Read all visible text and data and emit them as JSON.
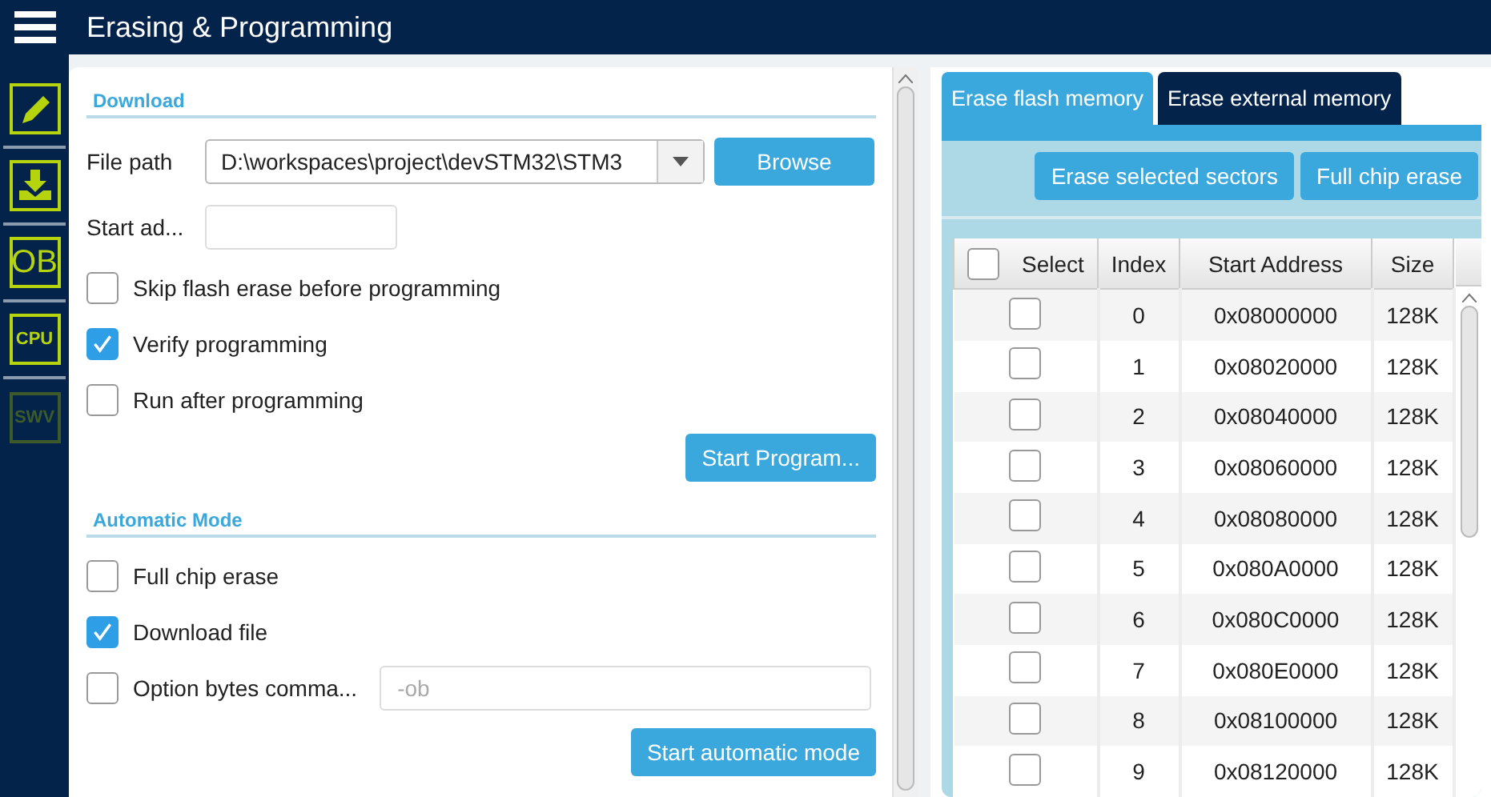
{
  "header": {
    "title": "Erasing & Programming"
  },
  "sidebar": {
    "items": [
      {
        "kind": "edit",
        "disabled": false
      },
      {
        "kind": "download",
        "disabled": false
      },
      {
        "kind": "text",
        "label": "OB",
        "disabled": false
      },
      {
        "kind": "text",
        "label": "CPU",
        "disabled": false
      },
      {
        "kind": "text",
        "label": "SWV",
        "disabled": true
      }
    ]
  },
  "download": {
    "title": "Download",
    "file_path": {
      "label": "File path",
      "value": "D:\\workspaces\\project\\devSTM32\\STM3"
    },
    "browse_button": "Browse",
    "start_address": {
      "label": "Start ad..."
    },
    "options": [
      {
        "label": "Skip flash erase before programming",
        "checked": false
      },
      {
        "label": "Verify programming",
        "checked": true
      },
      {
        "label": "Run after programming",
        "checked": false
      }
    ],
    "start_button": "Start Program..."
  },
  "automatic_mode": {
    "title": "Automatic Mode",
    "options": [
      {
        "label": "Full chip erase",
        "checked": false
      },
      {
        "label": "Download file",
        "checked": true
      },
      {
        "label": "Option bytes comma...",
        "checked": false,
        "placeholder": "-ob"
      }
    ],
    "start_button": "Start automatic mode"
  },
  "erase": {
    "tabs": [
      {
        "label": "Erase flash memory",
        "selected": true
      },
      {
        "label": "Erase external memory",
        "selected": false
      }
    ],
    "buttons": [
      "Erase selected sectors",
      "Full chip erase"
    ],
    "table": {
      "columns": [
        "Select",
        "Index",
        "Start Address",
        "Size"
      ],
      "select_all_checked": false,
      "rows": [
        {
          "checked": false,
          "index": "0",
          "address": "0x08000000",
          "size": "128K"
        },
        {
          "checked": false,
          "index": "1",
          "address": "0x08020000",
          "size": "128K"
        },
        {
          "checked": false,
          "index": "2",
          "address": "0x08040000",
          "size": "128K"
        },
        {
          "checked": false,
          "index": "3",
          "address": "0x08060000",
          "size": "128K"
        },
        {
          "checked": false,
          "index": "4",
          "address": "0x08080000",
          "size": "128K"
        },
        {
          "checked": false,
          "index": "5",
          "address": "0x080A0000",
          "size": "128K"
        },
        {
          "checked": false,
          "index": "6",
          "address": "0x080C0000",
          "size": "128K"
        },
        {
          "checked": false,
          "index": "7",
          "address": "0x080E0000",
          "size": "128K"
        },
        {
          "checked": false,
          "index": "8",
          "address": "0x08100000",
          "size": "128K"
        },
        {
          "checked": false,
          "index": "9",
          "address": "0x08120000",
          "size": "128K"
        }
      ]
    }
  }
}
